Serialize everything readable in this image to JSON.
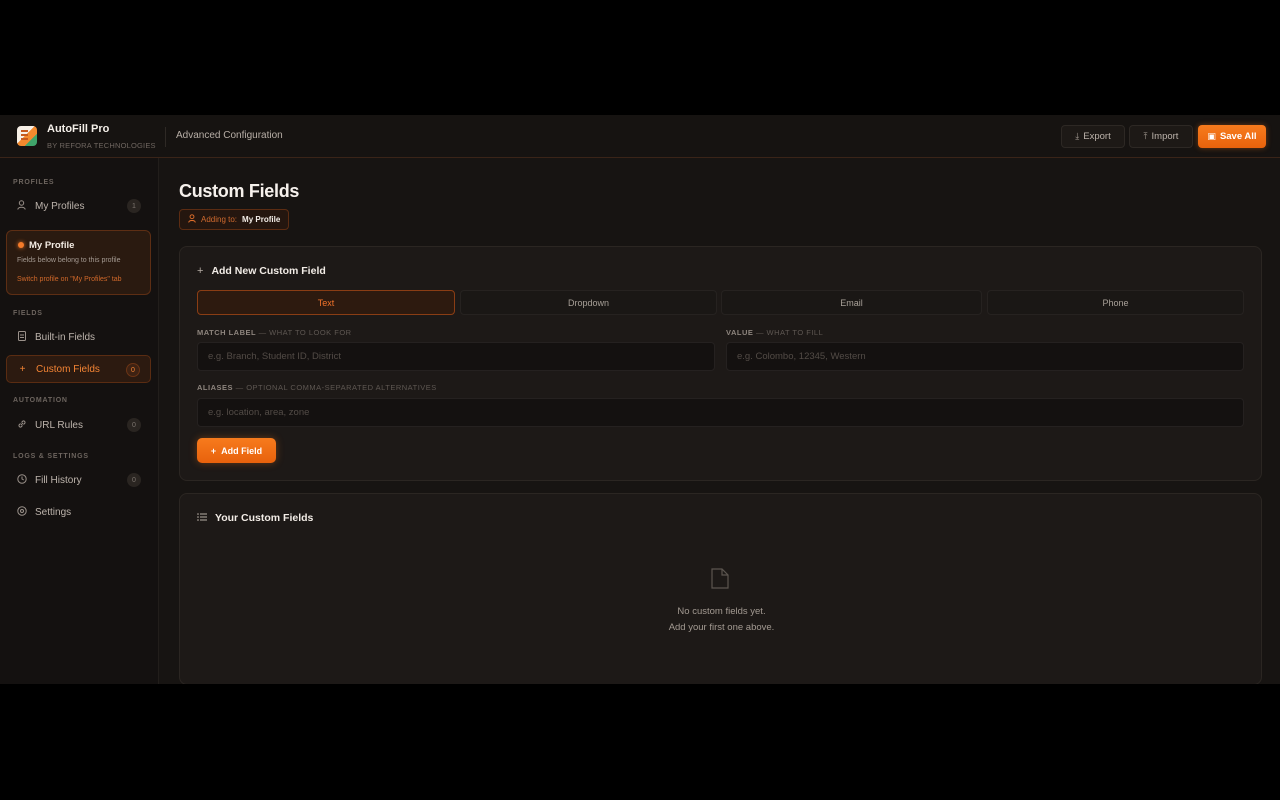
{
  "header": {
    "brand_name": "AutoFill Pro",
    "brand_sub": "BY REFORA TECHNOLOGIES",
    "page_context": "Advanced Configuration",
    "export_label": "Export",
    "import_label": "Import",
    "save_label": "Save All"
  },
  "sidebar": {
    "sections": {
      "profiles": "PROFILES",
      "fields": "FIELDS",
      "automation": "AUTOMATION",
      "logs": "LOGS & SETTINGS"
    },
    "items": {
      "my_profiles": {
        "label": "My Profiles",
        "count": "1"
      },
      "built_in_fields": {
        "label": "Built-in Fields"
      },
      "custom_fields": {
        "label": "Custom Fields",
        "count": "0"
      },
      "url_rules": {
        "label": "URL Rules",
        "count": "0"
      },
      "fill_history": {
        "label": "Fill History",
        "count": "0"
      },
      "settings": {
        "label": "Settings"
      }
    },
    "profile_card": {
      "name": "My Profile",
      "note": "Fields below belong to this profile",
      "switch_hint": "Switch profile on \"My Profiles\" tab"
    }
  },
  "main": {
    "title": "Custom Fields",
    "adding_label": "Adding to:",
    "adding_value": "My Profile",
    "add_card": {
      "title": "Add New Custom Field",
      "types": [
        "Text",
        "Dropdown",
        "Email",
        "Phone"
      ],
      "active_type": "Text",
      "match_label": "MATCH LABEL",
      "match_hint": "— WHAT TO LOOK FOR",
      "match_placeholder": "e.g. Branch, Student ID, District",
      "value_label": "VALUE",
      "value_hint": "— WHAT TO FILL",
      "value_placeholder": "e.g. Colombo, 12345, Western",
      "aliases_label": "ALIASES",
      "aliases_hint": "— OPTIONAL COMMA-SEPARATED ALTERNATIVES",
      "aliases_placeholder": "e.g. location, area, zone",
      "add_button": "Add Field"
    },
    "list_card": {
      "title": "Your Custom Fields",
      "empty_line1": "No custom fields yet.",
      "empty_line2": "Add your first one above."
    }
  },
  "colors": {
    "accent": "#f77b1d",
    "background": "#171412",
    "card": "#1d1917"
  },
  "icons": {
    "export": "download-icon",
    "import": "upload-icon",
    "save": "floppy-icon",
    "profiles": "user-icon",
    "built_in": "document-icon",
    "custom": "plus-icon",
    "url_rules": "link-icon",
    "history": "clock-icon",
    "settings": "gear-icon",
    "list": "list-icon",
    "empty": "file-icon"
  }
}
